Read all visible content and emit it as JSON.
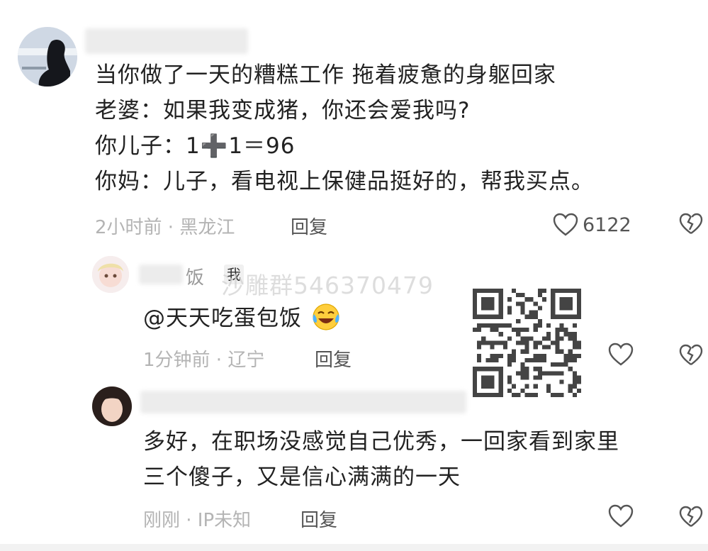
{
  "comments": [
    {
      "lines": [
        "当你做了一天的糟糕工作 拖着疲惫的身躯回家",
        "老婆：如果我变成猪，你还会爱我吗?",
        "你儿子：1➕1＝96",
        "你妈：儿子，看电视上保健品挺好的，帮我买点。"
      ],
      "meta": "2小时前 · 黑龙江",
      "reply_label": "回复",
      "like_count": "6122"
    },
    {
      "author_suffix": "饭",
      "author_badge": "我",
      "mention": "@天天吃蛋包饭",
      "meta": "1分钟前 · 辽宁",
      "reply_label": "回复"
    },
    {
      "lines": [
        "多好，在职场没感觉自己优秀，一回家看到家里",
        "三个傻子，又是信心满满的一天"
      ],
      "meta": "刚刚 · IP未知",
      "reply_label": "回复"
    }
  ],
  "watermark": "沙雕群546370479",
  "icons": {
    "like": "heart-outline-icon",
    "dislike": "broken-heart-icon",
    "emoji": "crying-laughing-emoji-icon",
    "qr": "qr-code-icon"
  }
}
